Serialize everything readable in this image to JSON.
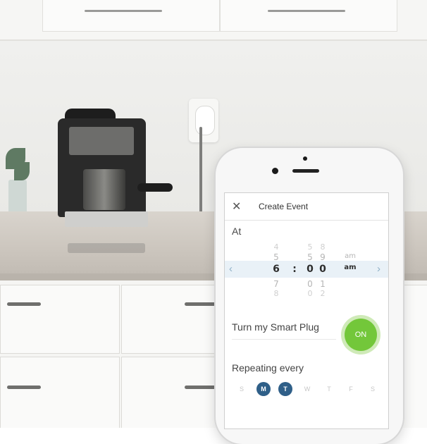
{
  "app": {
    "title": "Create Event",
    "close_icon": "close-icon",
    "at_label": "At"
  },
  "time_picker": {
    "hours": [
      "4",
      "5",
      "6",
      "7",
      "8"
    ],
    "minutes_tens": [
      "5",
      "5",
      "0",
      "0",
      "0"
    ],
    "minutes_ones": [
      "8",
      "9",
      "0",
      "1",
      "2"
    ],
    "ampm": [
      "",
      "am",
      "am",
      "",
      ""
    ],
    "separator": ":",
    "selected_index": 2
  },
  "action": {
    "label": "Turn my Smart Plug",
    "toggle_label": "ON",
    "toggle_color": "#73c73a"
  },
  "repeat": {
    "label": "Repeating every",
    "days": [
      "S",
      "M",
      "T",
      "W",
      "T",
      "F",
      "S"
    ],
    "active": [
      false,
      true,
      true,
      false,
      false,
      false,
      false
    ],
    "active_color": "#2f5f88"
  }
}
